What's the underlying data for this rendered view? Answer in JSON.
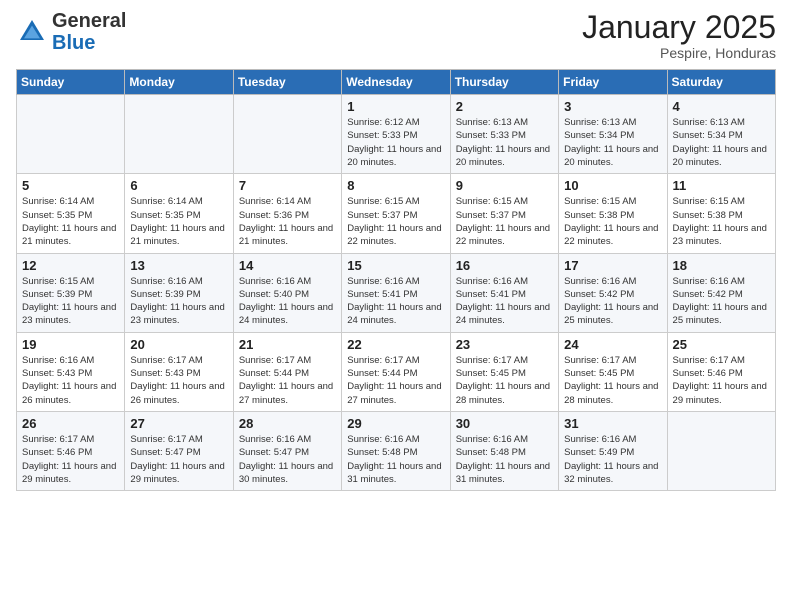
{
  "logo": {
    "general": "General",
    "blue": "Blue"
  },
  "header": {
    "month": "January 2025",
    "location": "Pespire, Honduras"
  },
  "weekdays": [
    "Sunday",
    "Monday",
    "Tuesday",
    "Wednesday",
    "Thursday",
    "Friday",
    "Saturday"
  ],
  "weeks": [
    [
      {
        "day": "",
        "info": ""
      },
      {
        "day": "",
        "info": ""
      },
      {
        "day": "",
        "info": ""
      },
      {
        "day": "1",
        "info": "Sunrise: 6:12 AM\nSunset: 5:33 PM\nDaylight: 11 hours and 20 minutes."
      },
      {
        "day": "2",
        "info": "Sunrise: 6:13 AM\nSunset: 5:33 PM\nDaylight: 11 hours and 20 minutes."
      },
      {
        "day": "3",
        "info": "Sunrise: 6:13 AM\nSunset: 5:34 PM\nDaylight: 11 hours and 20 minutes."
      },
      {
        "day": "4",
        "info": "Sunrise: 6:13 AM\nSunset: 5:34 PM\nDaylight: 11 hours and 20 minutes."
      }
    ],
    [
      {
        "day": "5",
        "info": "Sunrise: 6:14 AM\nSunset: 5:35 PM\nDaylight: 11 hours and 21 minutes."
      },
      {
        "day": "6",
        "info": "Sunrise: 6:14 AM\nSunset: 5:35 PM\nDaylight: 11 hours and 21 minutes."
      },
      {
        "day": "7",
        "info": "Sunrise: 6:14 AM\nSunset: 5:36 PM\nDaylight: 11 hours and 21 minutes."
      },
      {
        "day": "8",
        "info": "Sunrise: 6:15 AM\nSunset: 5:37 PM\nDaylight: 11 hours and 22 minutes."
      },
      {
        "day": "9",
        "info": "Sunrise: 6:15 AM\nSunset: 5:37 PM\nDaylight: 11 hours and 22 minutes."
      },
      {
        "day": "10",
        "info": "Sunrise: 6:15 AM\nSunset: 5:38 PM\nDaylight: 11 hours and 22 minutes."
      },
      {
        "day": "11",
        "info": "Sunrise: 6:15 AM\nSunset: 5:38 PM\nDaylight: 11 hours and 23 minutes."
      }
    ],
    [
      {
        "day": "12",
        "info": "Sunrise: 6:15 AM\nSunset: 5:39 PM\nDaylight: 11 hours and 23 minutes."
      },
      {
        "day": "13",
        "info": "Sunrise: 6:16 AM\nSunset: 5:39 PM\nDaylight: 11 hours and 23 minutes."
      },
      {
        "day": "14",
        "info": "Sunrise: 6:16 AM\nSunset: 5:40 PM\nDaylight: 11 hours and 24 minutes."
      },
      {
        "day": "15",
        "info": "Sunrise: 6:16 AM\nSunset: 5:41 PM\nDaylight: 11 hours and 24 minutes."
      },
      {
        "day": "16",
        "info": "Sunrise: 6:16 AM\nSunset: 5:41 PM\nDaylight: 11 hours and 24 minutes."
      },
      {
        "day": "17",
        "info": "Sunrise: 6:16 AM\nSunset: 5:42 PM\nDaylight: 11 hours and 25 minutes."
      },
      {
        "day": "18",
        "info": "Sunrise: 6:16 AM\nSunset: 5:42 PM\nDaylight: 11 hours and 25 minutes."
      }
    ],
    [
      {
        "day": "19",
        "info": "Sunrise: 6:16 AM\nSunset: 5:43 PM\nDaylight: 11 hours and 26 minutes."
      },
      {
        "day": "20",
        "info": "Sunrise: 6:17 AM\nSunset: 5:43 PM\nDaylight: 11 hours and 26 minutes."
      },
      {
        "day": "21",
        "info": "Sunrise: 6:17 AM\nSunset: 5:44 PM\nDaylight: 11 hours and 27 minutes."
      },
      {
        "day": "22",
        "info": "Sunrise: 6:17 AM\nSunset: 5:44 PM\nDaylight: 11 hours and 27 minutes."
      },
      {
        "day": "23",
        "info": "Sunrise: 6:17 AM\nSunset: 5:45 PM\nDaylight: 11 hours and 28 minutes."
      },
      {
        "day": "24",
        "info": "Sunrise: 6:17 AM\nSunset: 5:45 PM\nDaylight: 11 hours and 28 minutes."
      },
      {
        "day": "25",
        "info": "Sunrise: 6:17 AM\nSunset: 5:46 PM\nDaylight: 11 hours and 29 minutes."
      }
    ],
    [
      {
        "day": "26",
        "info": "Sunrise: 6:17 AM\nSunset: 5:46 PM\nDaylight: 11 hours and 29 minutes."
      },
      {
        "day": "27",
        "info": "Sunrise: 6:17 AM\nSunset: 5:47 PM\nDaylight: 11 hours and 29 minutes."
      },
      {
        "day": "28",
        "info": "Sunrise: 6:16 AM\nSunset: 5:47 PM\nDaylight: 11 hours and 30 minutes."
      },
      {
        "day": "29",
        "info": "Sunrise: 6:16 AM\nSunset: 5:48 PM\nDaylight: 11 hours and 31 minutes."
      },
      {
        "day": "30",
        "info": "Sunrise: 6:16 AM\nSunset: 5:48 PM\nDaylight: 11 hours and 31 minutes."
      },
      {
        "day": "31",
        "info": "Sunrise: 6:16 AM\nSunset: 5:49 PM\nDaylight: 11 hours and 32 minutes."
      },
      {
        "day": "",
        "info": ""
      }
    ]
  ]
}
